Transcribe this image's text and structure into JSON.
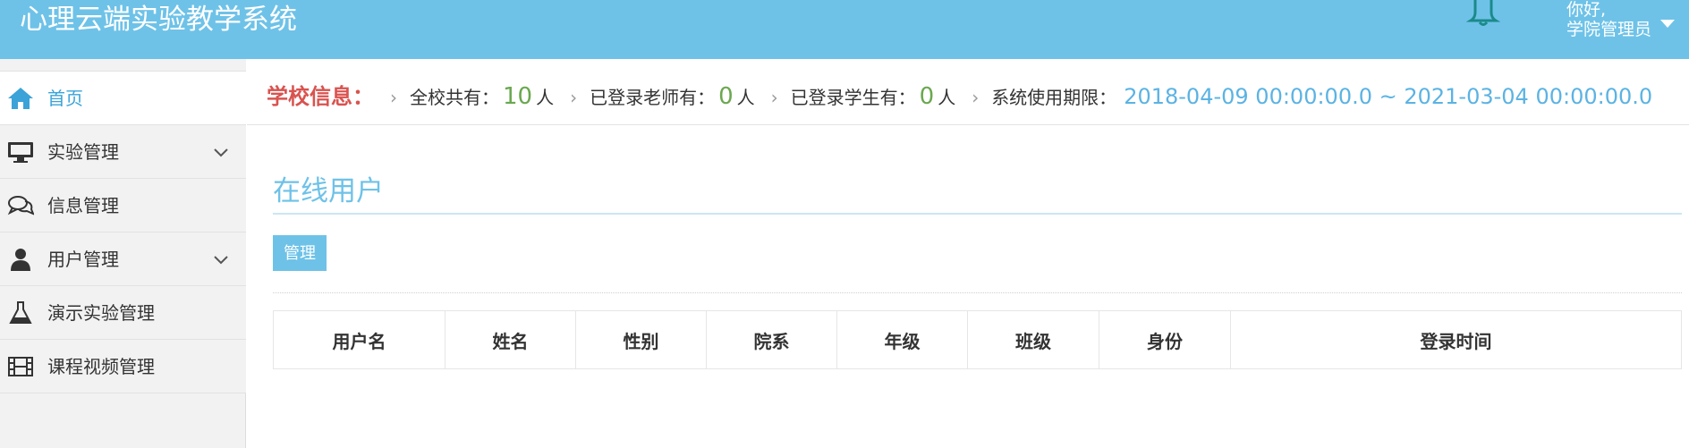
{
  "header": {
    "title": "心理云端实验教学系统",
    "greeting": "你好,",
    "username": "学院管理员",
    "bell_icon": "bell-icon",
    "caret_icon": "caret-down-icon"
  },
  "sidebar": {
    "items": [
      {
        "label": "首页",
        "icon": "home-icon",
        "active": true,
        "has_submenu": false
      },
      {
        "label": "实验管理",
        "icon": "monitor-icon",
        "active": false,
        "has_submenu": true
      },
      {
        "label": "信息管理",
        "icon": "chat-icon",
        "active": false,
        "has_submenu": false
      },
      {
        "label": "用户管理",
        "icon": "user-icon",
        "active": false,
        "has_submenu": true
      },
      {
        "label": "演示实验管理",
        "icon": "flask-icon",
        "active": false,
        "has_submenu": false
      },
      {
        "label": "课程视频管理",
        "icon": "film-icon",
        "active": false,
        "has_submenu": false
      }
    ]
  },
  "info": {
    "title": "学校信息：",
    "total_label": "全校共有：",
    "total_value": "10",
    "teachers_label": "已登录老师有：",
    "teachers_value": "0",
    "students_label": "已登录学生有：",
    "students_value": "0",
    "unit": "人",
    "period_label": "系统使用期限：",
    "period_value": "2018-04-09 00:00:00.0 ~ 2021-03-04 00:00:00.0",
    "separator": "›"
  },
  "main": {
    "section_title": "在线用户",
    "manage_button": "管理",
    "table": {
      "columns": [
        "用户名",
        "姓名",
        "性别",
        "院系",
        "年级",
        "班级",
        "身份",
        "登录时间"
      ],
      "rows": []
    }
  },
  "colors": {
    "header_bg": "#6ec2e8",
    "accent": "#6ec2e8",
    "info_title": "#d9534f",
    "count_green": "#6aa84f",
    "period_blue": "#5bb3e3"
  }
}
